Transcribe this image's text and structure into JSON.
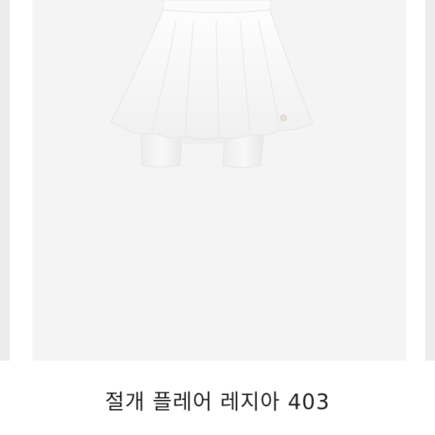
{
  "product": {
    "title": "절개 플레어 레지아 403",
    "image_icon": "white-flare-skirt-with-leggings-image"
  },
  "colors": {
    "card_background": "#f4f4f4",
    "edge_background": "#ececec",
    "title_text": "#222222",
    "garment": "#fafafa"
  }
}
